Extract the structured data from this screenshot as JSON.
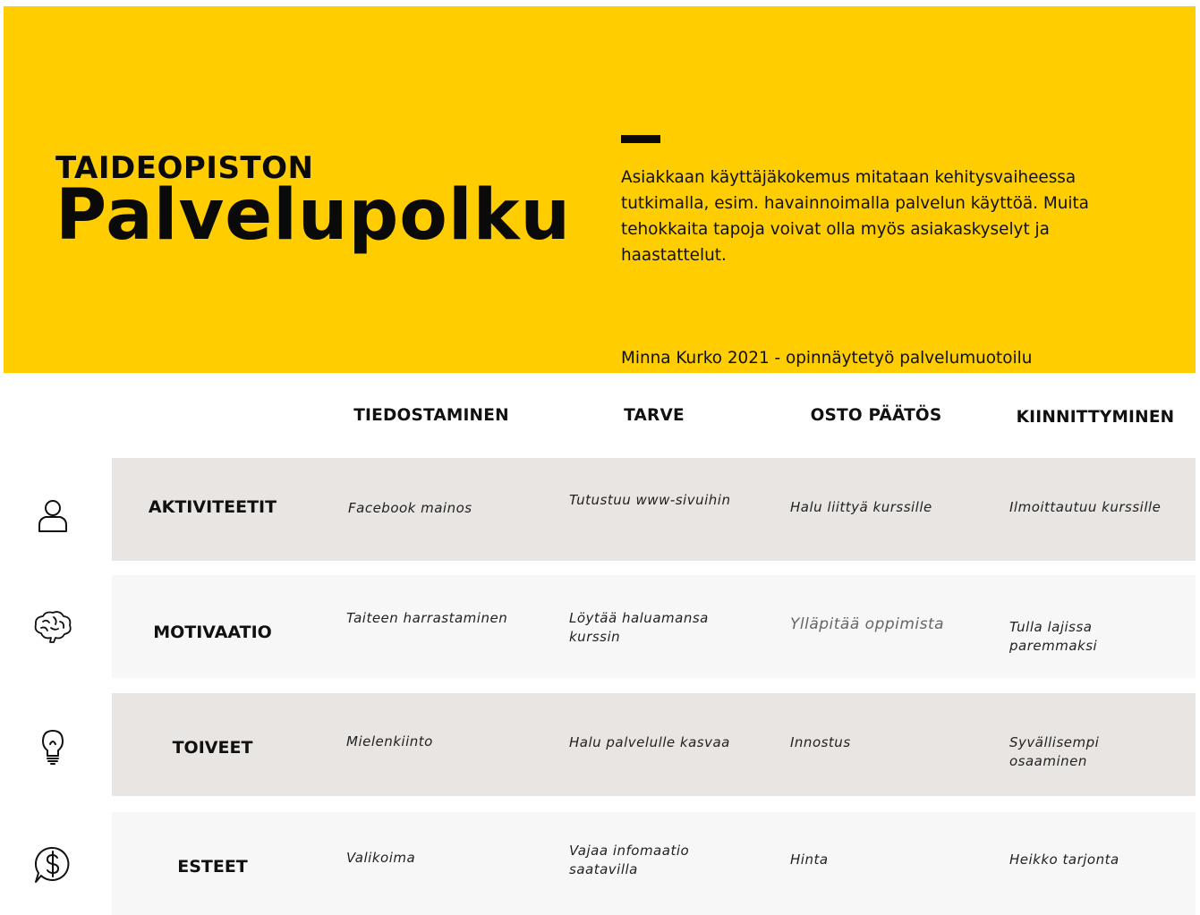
{
  "header": {
    "sup_title": "TAIDEOPISTON",
    "title": "Palvelupolku",
    "intro": "Asiakkaan käyttäjäkokemus mitataan kehitysvaiheessa tutkimalla, esim. havainnoimalla palvelun käyttöä. Muita tehokkaita tapoja voivat olla myös asiakaskyselyt ja haastattelut.",
    "author": "Minna Kurko 2021 - opinnäytetyö palvelumuotoilu",
    "accent_color": "#FFCD00"
  },
  "columns": [
    "TIEDOSTAMINEN",
    "TARVE",
    "OSTO PÄÄTÖS",
    "KIINNITTYMINEN"
  ],
  "rows": [
    {
      "label": "AKTIVITEETIT",
      "icon": "person-icon",
      "cells": [
        "Facebook mainos",
        "Tutustuu www-sivuihin",
        "Halu liittyä kurssille",
        "Ilmoittautuu kurssille"
      ]
    },
    {
      "label": "MOTIVAATIO",
      "icon": "brain-icon",
      "cells": [
        "Taiteen harrastaminen",
        "Löytää haluamansa kurssin",
        "Ylläpitää oppimista",
        "Tulla lajissa paremmaksi"
      ]
    },
    {
      "label": "TOIVEET",
      "icon": "lightbulb-icon",
      "cells": [
        "Mielenkiinto",
        "Halu palvelulle kasvaa",
        "Innostus",
        "Syvällisempi osaaminen"
      ]
    },
    {
      "label": "ESTEET",
      "icon": "money-speech-bubble-icon",
      "cells": [
        "Valikoima",
        "Vajaa infomaatio saatavilla",
        "Hinta",
        "Heikko tarjonta"
      ]
    }
  ]
}
